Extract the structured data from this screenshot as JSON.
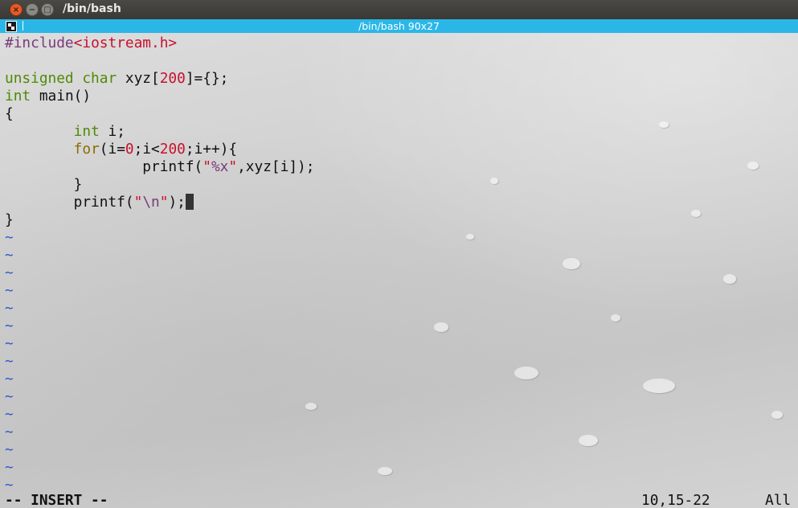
{
  "window": {
    "title": "/bin/bash",
    "close_glyph": "×",
    "minimize_glyph": "−",
    "maximize_glyph": "□"
  },
  "tab": {
    "title": "/bin/bash 90x27"
  },
  "editor": {
    "lines": [
      [
        {
          "t": "#include",
          "c": "c-pre"
        },
        {
          "t": "<iostream.h>",
          "c": "c-str"
        }
      ],
      [],
      [
        {
          "t": "unsigned char",
          "c": "c-type"
        },
        {
          "t": " xyz["
        },
        {
          "t": "200",
          "c": "c-num"
        },
        {
          "t": "]={};"
        }
      ],
      [
        {
          "t": "int",
          "c": "c-type"
        },
        {
          "t": " main()"
        }
      ],
      [
        {
          "t": "{"
        }
      ],
      [
        {
          "t": "        "
        },
        {
          "t": "int",
          "c": "c-type"
        },
        {
          "t": " i;"
        }
      ],
      [
        {
          "t": "        "
        },
        {
          "t": "for",
          "c": "c-kw"
        },
        {
          "t": "(i="
        },
        {
          "t": "0",
          "c": "c-num"
        },
        {
          "t": ";i<"
        },
        {
          "t": "200",
          "c": "c-num"
        },
        {
          "t": ";i++){"
        }
      ],
      [
        {
          "t": "                printf("
        },
        {
          "t": "\"",
          "c": "c-str"
        },
        {
          "t": "%x",
          "c": "c-esc"
        },
        {
          "t": "\"",
          "c": "c-str"
        },
        {
          "t": ",xyz[i]);"
        }
      ],
      [
        {
          "t": "        }"
        }
      ],
      [
        {
          "t": "        printf("
        },
        {
          "t": "\"",
          "c": "c-str"
        },
        {
          "t": "\\n",
          "c": "c-esc"
        },
        {
          "t": "\"",
          "c": "c-str"
        },
        {
          "t": ");"
        },
        {
          "cursor": true
        }
      ],
      [
        {
          "t": "}"
        }
      ]
    ],
    "tilde_count": 15,
    "tilde_glyph": "~"
  },
  "status": {
    "mode": "-- INSERT --",
    "position": "10,15-22",
    "scroll": "All"
  }
}
